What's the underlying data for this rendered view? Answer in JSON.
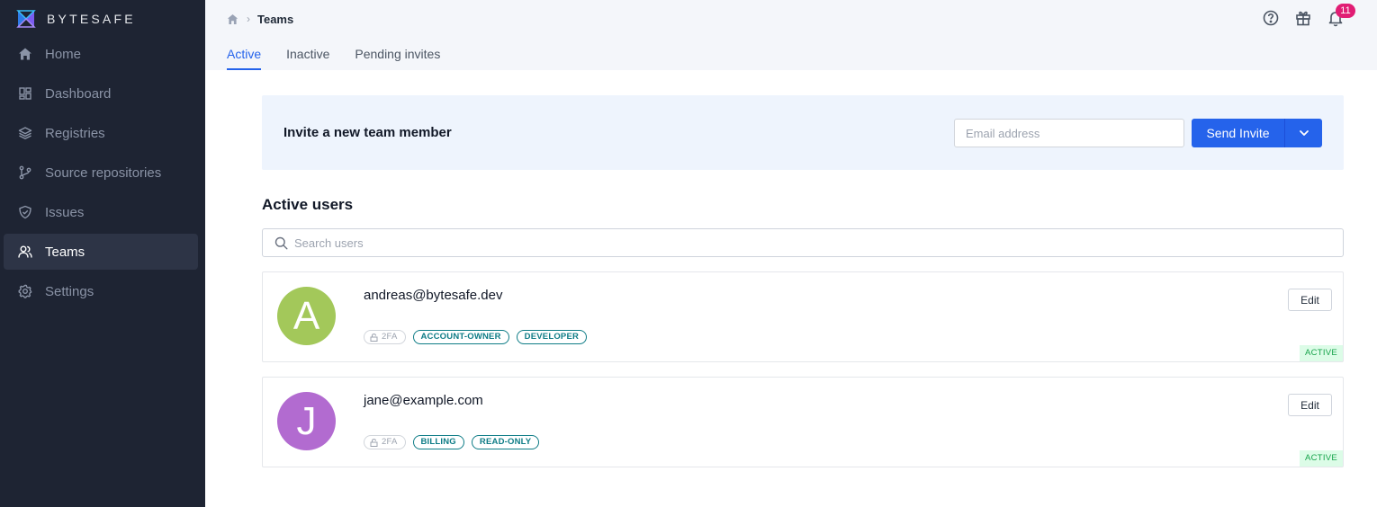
{
  "brand": {
    "name": "BYTESAFE"
  },
  "sidebar": {
    "items": [
      {
        "label": "Home",
        "icon": "home-icon"
      },
      {
        "label": "Dashboard",
        "icon": "dashboard-icon"
      },
      {
        "label": "Registries",
        "icon": "layers-icon"
      },
      {
        "label": "Source repositories",
        "icon": "branch-icon"
      },
      {
        "label": "Issues",
        "icon": "shield-icon"
      },
      {
        "label": "Teams",
        "icon": "users-icon",
        "active": true
      },
      {
        "label": "Settings",
        "icon": "gear-icon"
      }
    ]
  },
  "header": {
    "breadcrumb_current": "Teams",
    "notification_count": "11",
    "tabs": [
      "Active",
      "Inactive",
      "Pending invites"
    ]
  },
  "invite": {
    "title": "Invite a new team member",
    "email_placeholder": "Email address",
    "send_label": "Send Invite"
  },
  "users_section": {
    "title": "Active users",
    "search_placeholder": "Search users"
  },
  "users": [
    {
      "initial": "A",
      "email": "andreas@bytesafe.dev",
      "twofa": "2FA",
      "roles": [
        "ACCOUNT-OWNER",
        "DEVELOPER"
      ],
      "edit_label": "Edit",
      "status": "ACTIVE",
      "avatar_color": "#a3c85a"
    },
    {
      "initial": "J",
      "email": "jane@example.com",
      "twofa": "2FA",
      "roles": [
        "BILLING",
        "READ-ONLY"
      ],
      "edit_label": "Edit",
      "status": "ACTIVE",
      "avatar_color": "#b26bd0"
    }
  ],
  "colors": {
    "sidebar_bg": "#1e2433",
    "accent": "#2563eb",
    "notification": "#e11d74",
    "role_tag": "#0e7c86",
    "status_active": "#16a34a"
  }
}
